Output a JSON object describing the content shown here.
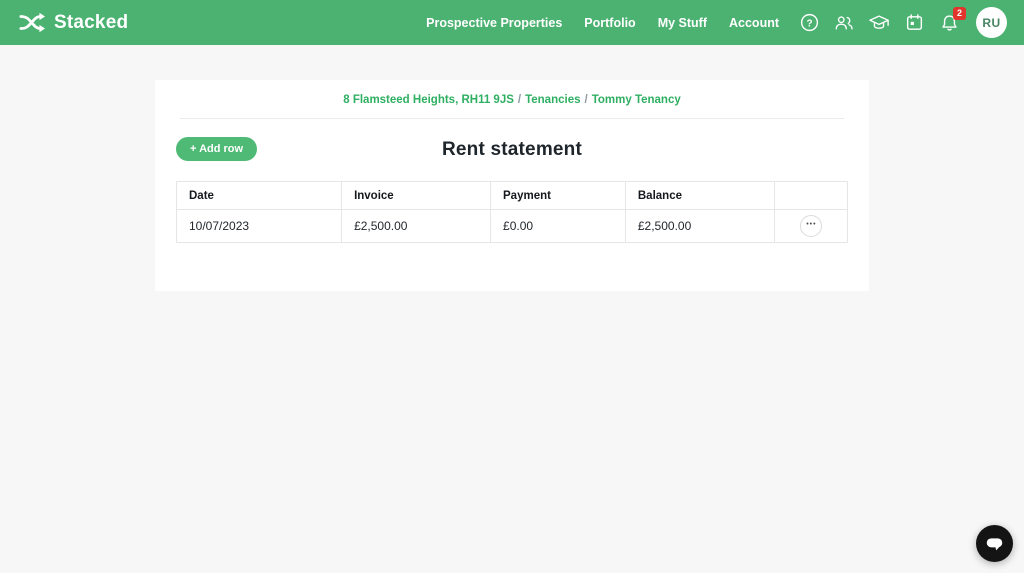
{
  "brand": {
    "name": "Stacked"
  },
  "nav": {
    "links": [
      {
        "label": "Prospective Properties"
      },
      {
        "label": "Portfolio"
      },
      {
        "label": "My Stuff"
      },
      {
        "label": "Account"
      }
    ],
    "notification_count": "2",
    "avatar_initials": "RU",
    "icons": [
      "shuffle-logo-icon",
      "help-icon",
      "users-icon",
      "graduation-cap-icon",
      "calendar-icon",
      "notifications-bell-icon"
    ]
  },
  "breadcrumb": {
    "separator": "/",
    "items": [
      {
        "label": "8 Flamsteed Heights, RH11 9JS"
      },
      {
        "label": "Tenancies"
      },
      {
        "label": "Tommy Tenancy"
      }
    ]
  },
  "toolbar": {
    "add_row_label": "+ Add row"
  },
  "page": {
    "title": "Rent statement"
  },
  "table": {
    "headers": [
      "Date",
      "Invoice",
      "Payment",
      "Balance",
      ""
    ],
    "rows": [
      {
        "date": "10/07/2023",
        "invoice": "£2,500.00",
        "payment": "£0.00",
        "balance": "£2,500.00"
      }
    ],
    "row_menu_glyph": "•••"
  },
  "colors": {
    "header_green": "#4BB271",
    "link_green": "#2FAF62",
    "button_green": "#4FBA75",
    "badge_red": "#E0342C",
    "page_bg": "#F7F7F7"
  }
}
